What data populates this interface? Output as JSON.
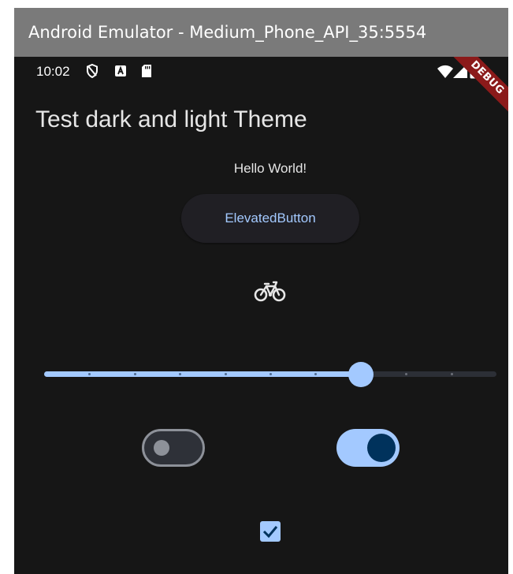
{
  "window": {
    "title": "Android Emulator - Medium_Phone_API_35:5554"
  },
  "status_bar": {
    "time": "10:02",
    "left_icons": [
      "shield-icon",
      "a-notification-icon",
      "sd-card-icon"
    ],
    "right_icons": [
      "wifi-icon",
      "signal-icon",
      "battery-icon"
    ]
  },
  "debug_banner": {
    "label": "DEBUG",
    "color": "#8b1a1a"
  },
  "app": {
    "title": "Test dark and light Theme",
    "hello_text": "Hello World!",
    "elevated_button_label": "ElevatedButton",
    "icon": "bike-icon",
    "slider": {
      "value": 0.7,
      "divisions": 10
    },
    "switch_off": {
      "checked": false
    },
    "switch_on": {
      "checked": true
    },
    "checkbox": {
      "checked": true
    }
  },
  "colors": {
    "background": "#161616",
    "primary": "#a3c9ff",
    "on_primary": "#00325c",
    "surface_container": "#201f24",
    "outline": "#8d9199",
    "track_inactive": "#2c2f36",
    "text": "#e6e6e6"
  }
}
